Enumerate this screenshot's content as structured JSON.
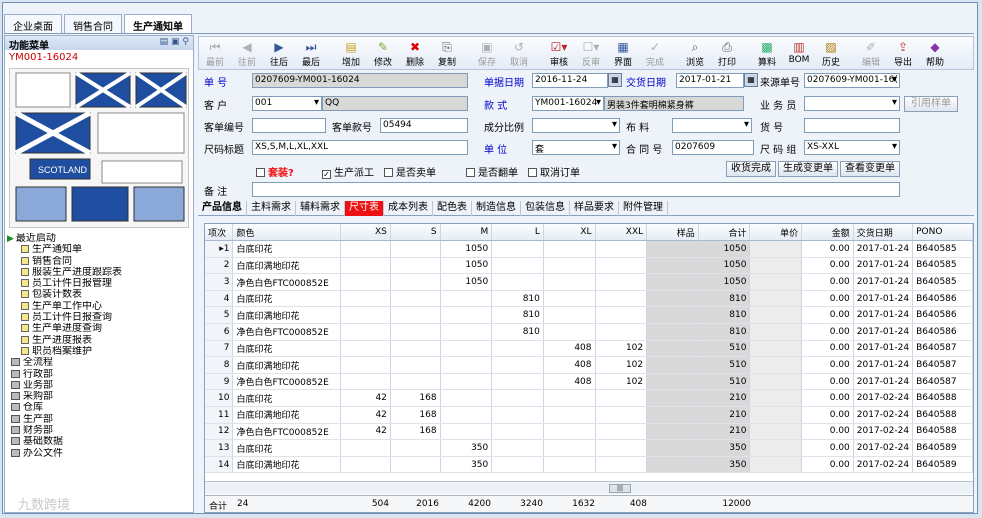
{
  "window": {
    "tabs": [
      "企业桌面",
      "销售合同",
      "生产通知单"
    ],
    "active_tab": "生产通知单"
  },
  "left_panel": {
    "title": "功能菜单",
    "code": "YM001-16024",
    "preview_label": "SCOTLAND",
    "tree": [
      {
        "label": "最近启动",
        "level": 0,
        "icon": "arrow-icon"
      },
      {
        "label": "生产通知单",
        "level": 1
      },
      {
        "label": "销售合同",
        "level": 1
      },
      {
        "label": "服装生产进度跟踪表",
        "level": 1
      },
      {
        "label": "员工计件日报管理",
        "level": 1
      },
      {
        "label": "包装计数表",
        "level": 1
      },
      {
        "label": "生产单工作中心",
        "level": 1
      },
      {
        "label": "员工计件日报查询",
        "level": 1
      },
      {
        "label": "生产单进度查询",
        "level": 1
      },
      {
        "label": "生产进度报表",
        "level": 1
      },
      {
        "label": "职员档案维护",
        "level": 1
      },
      {
        "label": "全流程",
        "level": 0
      },
      {
        "label": "行政部",
        "level": 0
      },
      {
        "label": "业务部",
        "level": 0
      },
      {
        "label": "采购部",
        "level": 0
      },
      {
        "label": "仓库",
        "level": 0
      },
      {
        "label": "生产部",
        "level": 0
      },
      {
        "label": "财务部",
        "level": 0
      },
      {
        "label": "基础数据",
        "level": 0
      },
      {
        "label": "办公文件",
        "level": 0
      }
    ]
  },
  "toolbar": {
    "buttons": [
      {
        "label": "最前",
        "icon": "first-icon",
        "enabled": false
      },
      {
        "label": "往前",
        "icon": "prev-icon",
        "enabled": false
      },
      {
        "label": "往后",
        "icon": "next-icon",
        "enabled": true
      },
      {
        "label": "最后",
        "icon": "last-icon",
        "enabled": true
      },
      {
        "label": "增加",
        "icon": "add-icon",
        "enabled": true
      },
      {
        "label": "修改",
        "icon": "edit-icon",
        "enabled": true
      },
      {
        "label": "删除",
        "icon": "delete-icon",
        "enabled": true
      },
      {
        "label": "复制",
        "icon": "copy-icon",
        "enabled": true
      },
      {
        "label": "保存",
        "icon": "save-icon",
        "enabled": false
      },
      {
        "label": "取消",
        "icon": "cancel-icon",
        "enabled": false
      },
      {
        "label": "审核",
        "icon": "approve-icon",
        "enabled": true
      },
      {
        "label": "反审",
        "icon": "unapprove-icon",
        "enabled": false
      },
      {
        "label": "界面",
        "icon": "layout-icon",
        "enabled": true
      },
      {
        "label": "完成",
        "icon": "complete-icon",
        "enabled": false
      },
      {
        "label": "浏览",
        "icon": "browse-icon",
        "enabled": true
      },
      {
        "label": "打印",
        "icon": "print-icon",
        "enabled": true
      },
      {
        "label": "算料",
        "icon": "calc-icon",
        "enabled": true
      },
      {
        "label": "BOM",
        "icon": "bom-icon",
        "enabled": true
      },
      {
        "label": "历史",
        "icon": "history-icon",
        "enabled": true
      },
      {
        "label": "编辑",
        "icon": "pencil-icon",
        "enabled": false
      },
      {
        "label": "导出",
        "icon": "export-icon",
        "enabled": true
      },
      {
        "label": "帮助",
        "icon": "help-icon",
        "enabled": true
      }
    ]
  },
  "form": {
    "order_no_label": "单    号",
    "order_no": "0207609-YM001-16024",
    "order_date_label": "单据日期",
    "order_date": "2016-11-24",
    "delivery_date_label": "交货日期",
    "delivery_date": "2017-01-21",
    "source_no_label": "来源单号",
    "source_no": "0207609-YM001-16(",
    "customer_label": "客    户",
    "customer_code": "001",
    "customer_name": "QQ",
    "style_label": "款    式",
    "style_code": "YM001-16024",
    "style_name": "男装3件套明棉紧身裤",
    "salesman_label": "业 务 员",
    "salesman": "",
    "quote_button": "引用样单",
    "customer_no_label": "客单编号",
    "customer_no": "",
    "customer_style_label": "客单款号",
    "customer_style": "05494",
    "composition_label": "成分比例",
    "composition": "",
    "fabric_label": "布    料",
    "fabric": "",
    "goods_no_label": "货    号",
    "goods_no": "",
    "size_title_label": "尺码标题",
    "size_title": "XS,S,M,L,XL,XXL",
    "unit_label": "单    位",
    "unit": "套",
    "contract_label": "合 同 号",
    "contract": "0207609",
    "size_group_label": "尺 码 组",
    "size_group": "XS-XXL",
    "checks": [
      {
        "label": "套装?",
        "checked": false,
        "red": true
      },
      {
        "label": "生产派工",
        "checked": true,
        "red": false
      },
      {
        "label": "是否卖单",
        "checked": false,
        "red": false
      },
      {
        "label": "是否翻单",
        "checked": false,
        "red": false
      },
      {
        "label": "取消订单",
        "checked": false,
        "red": false
      }
    ],
    "buttons": [
      "收货完成",
      "生成变更单",
      "查看变更单"
    ],
    "remark_label": "备    注",
    "remark": ""
  },
  "subtabs": [
    "产品信息",
    "主料需求",
    "辅料需求",
    "尺寸表",
    "成本列表",
    "配色表",
    "制造信息",
    "包装信息",
    "样品要求",
    "附件管理"
  ],
  "grid": {
    "columns": [
      "项次",
      "颜色",
      "XS",
      "S",
      "M",
      "L",
      "XL",
      "XXL",
      "样品",
      "合计",
      "单价",
      "金额",
      "交货日期",
      "PONO"
    ],
    "rows": [
      [
        "1",
        "白底印花",
        "",
        "",
        "1050",
        "",
        "",
        "",
        "",
        "1050",
        "",
        "0.00",
        "2017-01-24",
        "B640585"
      ],
      [
        "2",
        "白底印满地印花",
        "",
        "",
        "1050",
        "",
        "",
        "",
        "",
        "1050",
        "",
        "0.00",
        "2017-01-24",
        "B640585"
      ],
      [
        "3",
        "净色白色FTC000852E",
        "",
        "",
        "1050",
        "",
        "",
        "",
        "",
        "1050",
        "",
        "0.00",
        "2017-01-24",
        "B640585"
      ],
      [
        "4",
        "白底印花",
        "",
        "",
        "",
        "810",
        "",
        "",
        "",
        "810",
        "",
        "0.00",
        "2017-01-24",
        "B640586"
      ],
      [
        "5",
        "白底印满地印花",
        "",
        "",
        "",
        "810",
        "",
        "",
        "",
        "810",
        "",
        "0.00",
        "2017-01-24",
        "B640586"
      ],
      [
        "6",
        "净色白色FTC000852E",
        "",
        "",
        "",
        "810",
        "",
        "",
        "",
        "810",
        "",
        "0.00",
        "2017-01-24",
        "B640586"
      ],
      [
        "7",
        "白底印花",
        "",
        "",
        "",
        "",
        "408",
        "102",
        "",
        "510",
        "",
        "0.00",
        "2017-01-24",
        "B640587"
      ],
      [
        "8",
        "白底印满地印花",
        "",
        "",
        "",
        "",
        "408",
        "102",
        "",
        "510",
        "",
        "0.00",
        "2017-01-24",
        "B640587"
      ],
      [
        "9",
        "净色白色FTC000852E",
        "",
        "",
        "",
        "",
        "408",
        "102",
        "",
        "510",
        "",
        "0.00",
        "2017-01-24",
        "B640587"
      ],
      [
        "10",
        "白底印花",
        "42",
        "168",
        "",
        "",
        "",
        "",
        "",
        "210",
        "",
        "0.00",
        "2017-02-24",
        "B640588"
      ],
      [
        "11",
        "白底印满地印花",
        "42",
        "168",
        "",
        "",
        "",
        "",
        "",
        "210",
        "",
        "0.00",
        "2017-02-24",
        "B640588"
      ],
      [
        "12",
        "净色白色FTC000852E",
        "42",
        "168",
        "",
        "",
        "",
        "",
        "",
        "210",
        "",
        "0.00",
        "2017-02-24",
        "B640588"
      ],
      [
        "13",
        "白底印花",
        "",
        "",
        "350",
        "",
        "",
        "",
        "",
        "350",
        "",
        "0.00",
        "2017-02-24",
        "B640589"
      ],
      [
        "14",
        "白底印满地印花",
        "",
        "",
        "350",
        "",
        "",
        "",
        "",
        "350",
        "",
        "0.00",
        "2017-02-24",
        "B640589"
      ]
    ],
    "summary": {
      "label": "合计",
      "count": "24",
      "xs": "504",
      "s": "2016",
      "m": "4200",
      "l": "3240",
      "xl": "1632",
      "xxl": "408",
      "total": "12000"
    }
  },
  "watermark": "九数跨境",
  "colors": {
    "accent": "#0000cc",
    "alert": "#e11111",
    "frame": "#6f8fb5"
  }
}
